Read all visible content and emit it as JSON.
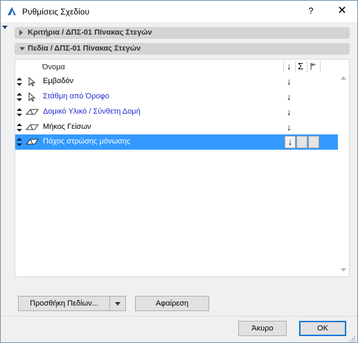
{
  "window": {
    "title": "Ρυθμίσεις Σχεδίου",
    "help_label": "?",
    "close_label": "✕"
  },
  "sections": {
    "criteria_label": "Κριτήρια / ΔΠΣ-01 Πίνακας Στεγών",
    "fields_label": "Πεδία / ΔΠΣ-01 Πίνακας Στεγών"
  },
  "table": {
    "columns": {
      "name": "Όνομα",
      "sort": "↓",
      "sum": "Σ",
      "flag": "flag-icon"
    },
    "rows": [
      {
        "name": "Εμβαδόν",
        "type_icon": "pointer-icon",
        "sort": "↓",
        "color": "#000000"
      },
      {
        "name": "Στάθμη από Όροφο",
        "type_icon": "pointer-icon",
        "sort": "↓",
        "color": "#2a2ad0"
      },
      {
        "name": "Δομικό Υλικό / Σύνθετη Δομή",
        "type_icon": "roof-icon",
        "sort": "↓",
        "color": "#2a2ad0"
      },
      {
        "name": "Μήκος Γείσων",
        "type_icon": "roof-icon",
        "sort": "↓",
        "color": "#000000"
      },
      {
        "name": "Πάχος στρώσης μόνωσης",
        "type_icon": "roof-icon",
        "sort": "↓",
        "color": "#ffffff",
        "selected": true
      }
    ]
  },
  "buttons": {
    "add_fields": "Προσθήκη Πεδίων...",
    "remove": "Αφαίρεση",
    "cancel": "Άκυρο",
    "ok": "OK"
  },
  "colors": {
    "selection": "#3399ff",
    "accent": "#0078d7",
    "section_bar": "#d4d4d4"
  }
}
